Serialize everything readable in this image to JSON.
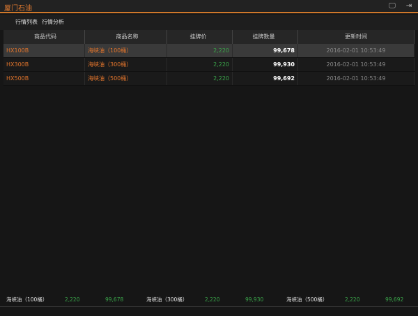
{
  "window": {
    "title": "厦门石油"
  },
  "tabs": [
    {
      "label": "行情列表"
    },
    {
      "label": "行情分析"
    }
  ],
  "table": {
    "headers": [
      "商品代码",
      "商品名称",
      "挂牌价",
      "挂牌数量",
      "更新时间"
    ],
    "rows": [
      {
        "code": "HX100B",
        "name": "海峡油（100桶）",
        "price": "2,220",
        "qty": "99,678",
        "time": "2016-02-01 10:53:49"
      },
      {
        "code": "HX300B",
        "name": "海峡油（300桶）",
        "price": "2,220",
        "qty": "99,930",
        "time": "2016-02-01 10:53:49"
      },
      {
        "code": "HX500B",
        "name": "海峡油（500桶）",
        "price": "2,220",
        "qty": "99,692",
        "time": "2016-02-01 10:53:49"
      }
    ]
  },
  "footer": [
    {
      "name": "海峡油（100桶）",
      "price": "2,220",
      "qty": "99,678"
    },
    {
      "name": "海峡油（300桶）",
      "price": "2,220",
      "qty": "99,930"
    },
    {
      "name": "海峡油（500桶）",
      "price": "2,220",
      "qty": "99,692"
    }
  ]
}
